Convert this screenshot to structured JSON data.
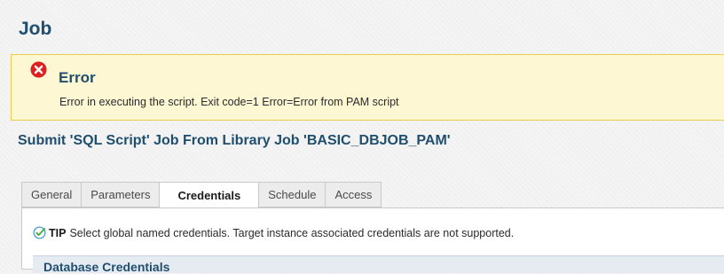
{
  "page": {
    "title": "Job"
  },
  "error": {
    "title": "Error",
    "message": "Error in executing the script. Exit code=1 Error=Error from PAM script",
    "icon": "error-x-icon",
    "color": "#e02020"
  },
  "subtitle": "Submit 'SQL Script' Job From Library Job 'BASIC_DBJOB_PAM'",
  "tabs": [
    {
      "label": "General",
      "active": false
    },
    {
      "label": "Parameters",
      "active": false
    },
    {
      "label": "Credentials",
      "active": true
    },
    {
      "label": "Schedule",
      "active": false
    },
    {
      "label": "Access",
      "active": false
    }
  ],
  "tip": {
    "label": "TIP",
    "text": "Select global named credentials. Target instance associated credentials are not supported.",
    "icon": "checkmark-circle-icon"
  },
  "section": {
    "title": "Database Credentials"
  },
  "colors": {
    "heading": "#1f4e6e",
    "error_bg": "#fdf7d4",
    "error_border": "#e8cd4e"
  }
}
